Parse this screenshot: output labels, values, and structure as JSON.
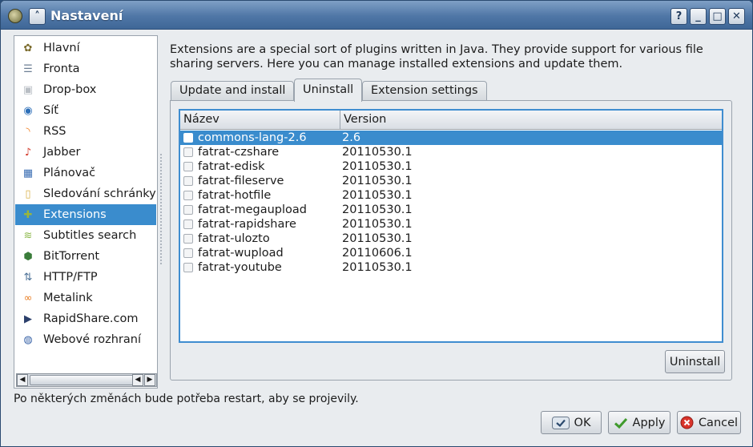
{
  "window": {
    "title": "Nastavení"
  },
  "titlebar_buttons": {
    "help": "?",
    "minimize": "_",
    "maximize": "□",
    "close": "✕",
    "shade": "˄"
  },
  "sidebar": {
    "items": [
      {
        "label": "Hlavní",
        "icon": "general-icon",
        "glyph": "✿",
        "color": "#7a6a2a"
      },
      {
        "label": "Fronta",
        "icon": "queue-icon",
        "glyph": "☰",
        "color": "#6d7f94"
      },
      {
        "label": "Drop-box",
        "icon": "box-icon",
        "glyph": "▣",
        "color": "#b9bec4"
      },
      {
        "label": "Síť",
        "icon": "network-globe-icon",
        "glyph": "◉",
        "color": "#2d6fb8"
      },
      {
        "label": "RSS",
        "icon": "rss-icon",
        "glyph": "◝",
        "color": "#f07a18"
      },
      {
        "label": "Jabber",
        "icon": "jabber-icon",
        "glyph": "♪",
        "color": "#d33a2a"
      },
      {
        "label": "Plánovač",
        "icon": "calendar-icon",
        "glyph": "▦",
        "color": "#3a6db3"
      },
      {
        "label": "Sledování schránky",
        "icon": "clipboard-icon",
        "glyph": "▯",
        "color": "#d9b24a"
      },
      {
        "label": "Extensions",
        "icon": "puzzle-icon",
        "glyph": "✚",
        "color": "#9ab63b"
      },
      {
        "label": "Subtitles search",
        "icon": "subtitles-icon",
        "glyph": "≋",
        "color": "#8cb84a"
      },
      {
        "label": "BitTorrent",
        "icon": "bittorrent-icon",
        "glyph": "⬢",
        "color": "#3a7c3a"
      },
      {
        "label": "HTTP/FTP",
        "icon": "network-icon",
        "glyph": "⇅",
        "color": "#4a6f95"
      },
      {
        "label": "Metalink",
        "icon": "metalink-icon",
        "glyph": "∞",
        "color": "#e87a1e"
      },
      {
        "label": "RapidShare.com",
        "icon": "rapidshare-icon",
        "glyph": "▶",
        "color": "#2b3f6b"
      },
      {
        "label": "Webové rozhraní",
        "icon": "web-interface-icon",
        "glyph": "◍",
        "color": "#3a64a8"
      }
    ],
    "selected_index": 8
  },
  "description": "Extensions are a special sort of plugins written in Java. They provide support for various file sharing servers. Here you can manage installed extensions and update them.",
  "tabs": [
    {
      "label": "Update and install"
    },
    {
      "label": "Uninstall"
    },
    {
      "label": "Extension settings"
    }
  ],
  "active_tab": 1,
  "table": {
    "columns": [
      "Název",
      "Version"
    ],
    "rows": [
      {
        "name": "commons-lang-2.6",
        "version": "2.6",
        "checked": false
      },
      {
        "name": "fatrat-czshare",
        "version": "20110530.1",
        "checked": false
      },
      {
        "name": "fatrat-edisk",
        "version": "20110530.1",
        "checked": false
      },
      {
        "name": "fatrat-fileserve",
        "version": "20110530.1",
        "checked": false
      },
      {
        "name": "fatrat-hotfile",
        "version": "20110530.1",
        "checked": false
      },
      {
        "name": "fatrat-megaupload",
        "version": "20110530.1",
        "checked": false
      },
      {
        "name": "fatrat-rapidshare",
        "version": "20110530.1",
        "checked": false
      },
      {
        "name": "fatrat-ulozto",
        "version": "20110530.1",
        "checked": false
      },
      {
        "name": "fatrat-wupload",
        "version": "20110606.1",
        "checked": false
      },
      {
        "name": "fatrat-youtube",
        "version": "20110530.1",
        "checked": false
      }
    ],
    "selected_index": 0
  },
  "buttons": {
    "uninstall": "Uninstall",
    "ok": "OK",
    "apply": "Apply",
    "cancel": "Cancel"
  },
  "status_text": "Po některých změnách bude potřeba restart, aby se projevily.",
  "colors": {
    "selection": "#3a8ccd",
    "titlebar": "#4f76a6"
  }
}
